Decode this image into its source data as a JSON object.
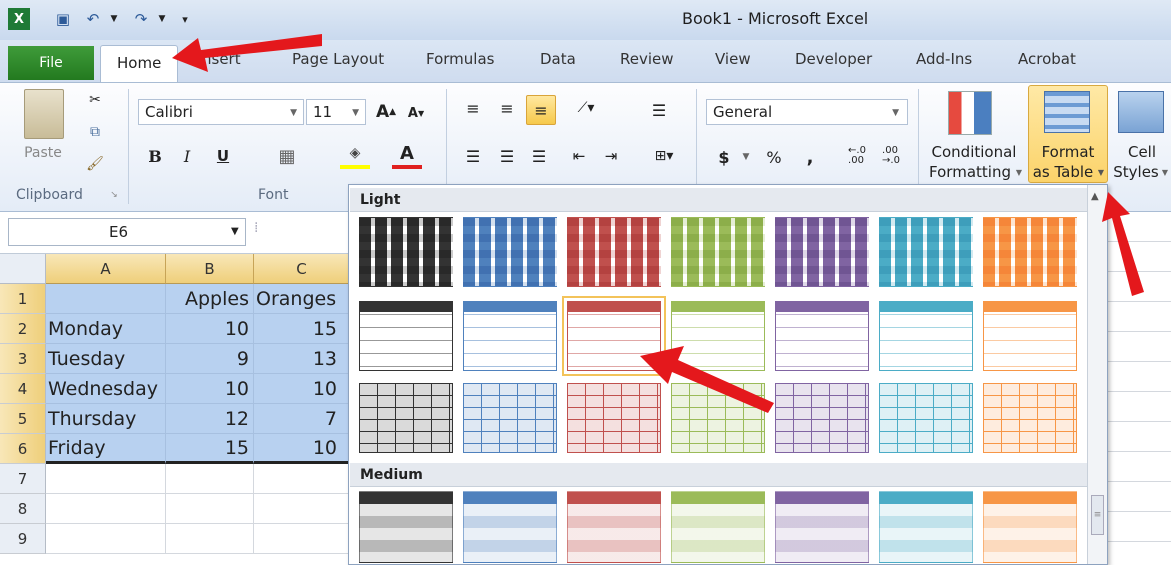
{
  "window": {
    "title": "Book1 - Microsoft Excel"
  },
  "quick_access": {
    "undo_icon": "undo-icon",
    "redo_icon": "redo-icon",
    "save_icon": "save-icon",
    "excel_icon": "excel-icon"
  },
  "tabs": {
    "file": "File",
    "home": "Home",
    "insert": "nsert",
    "page_layout": "Page Layout",
    "formulas": "Formulas",
    "data": "Data",
    "review": "Review",
    "view": "View",
    "developer": "Developer",
    "addins": "Add-Ins",
    "acrobat": "Acrobat"
  },
  "ribbon": {
    "paste": "Paste",
    "clipboard": "Clipboard",
    "font_group": "Font",
    "font_name": "Calibri",
    "font_size": "11",
    "bold": "B",
    "italic": "I",
    "underline": "U",
    "number_format": "General",
    "currency": "$",
    "percent": "%",
    "comma": ",",
    "inc_dec": ".0 .00",
    "conditional1": "Conditional",
    "conditional2": "Formatting",
    "format_table1": "Format",
    "format_table2": "as Table",
    "cell_styles1": "Cell",
    "cell_styles2": "Styles"
  },
  "formula_bar": {
    "name_box": "E6"
  },
  "sheet": {
    "columns": [
      "A",
      "B",
      "C"
    ],
    "rows": [
      {
        "n": "1",
        "a": "",
        "b": "Apples",
        "c": "Oranges"
      },
      {
        "n": "2",
        "a": "Monday",
        "b": "10",
        "c": "15"
      },
      {
        "n": "3",
        "a": "Tuesday",
        "b": "9",
        "c": "13"
      },
      {
        "n": "4",
        "a": "Wednesday",
        "b": "10",
        "c": "10"
      },
      {
        "n": "5",
        "a": "Thursday",
        "b": "12",
        "c": "7"
      },
      {
        "n": "6",
        "a": "Friday",
        "b": "15",
        "c": "10"
      },
      {
        "n": "7",
        "a": "",
        "b": "",
        "c": ""
      },
      {
        "n": "8",
        "a": "",
        "b": "",
        "c": ""
      },
      {
        "n": "9",
        "a": "",
        "b": "",
        "c": ""
      }
    ]
  },
  "gallery": {
    "light_label": "Light",
    "medium_label": "Medium",
    "style_colors": [
      "#333333",
      "#4f81bd",
      "#c0504d",
      "#9bbb59",
      "#8064a2",
      "#4bacc6",
      "#f79646"
    ]
  }
}
